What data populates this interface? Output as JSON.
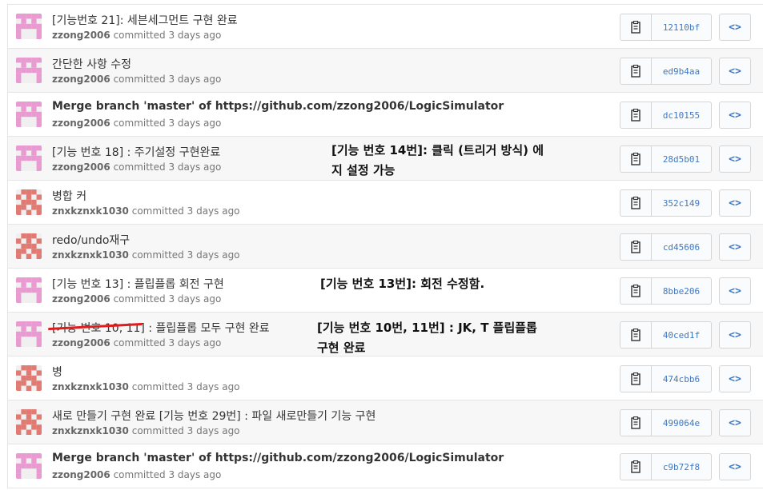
{
  "commits": [
    {
      "title": "[기능번호 21]: 세븐세그먼트 구현 완료",
      "author": "zzong2006",
      "action": "committed",
      "time": "3 days ago",
      "sha": "12110bf",
      "avatar": "pink"
    },
    {
      "title": "간단한 사항 수정",
      "author": "zzong2006",
      "action": "committed",
      "time": "3 days ago",
      "sha": "ed9b4aa",
      "avatar": "pink"
    },
    {
      "title": "Merge branch 'master' of https://github.com/zzong2006/LogicSimulator",
      "author": "zzong2006",
      "action": "committed",
      "time": "3 days ago",
      "sha": "dc10155",
      "avatar": "pink",
      "strong": true
    },
    {
      "title": "[기능 번호 18] : 주기설정 구현완료",
      "author": "zzong2006",
      "action": "committed",
      "time": "3 days ago",
      "sha": "28d5b01",
      "avatar": "pink"
    },
    {
      "title": "병합 커",
      "author": "znxkznxk1030",
      "action": "committed",
      "time": "3 days ago",
      "sha": "352c149",
      "avatar": "red"
    },
    {
      "title": "redo/undo재구",
      "author": "znxkznxk1030",
      "action": "committed",
      "time": "3 days ago",
      "sha": "cd45606",
      "avatar": "red"
    },
    {
      "title": "[기능 번호 13] : 플립플롭 회전 구현",
      "author": "zzong2006",
      "action": "committed",
      "time": "3 days ago",
      "sha": "8bbe206",
      "avatar": "pink"
    },
    {
      "title": "[기능 번호 10, 11] : 플립플롭 모두 구현 완료",
      "author": "zzong2006",
      "action": "committed",
      "time": "3 days ago",
      "sha": "40ced1f",
      "avatar": "pink"
    },
    {
      "title": "병",
      "author": "znxkznxk1030",
      "action": "committed",
      "time": "3 days ago",
      "sha": "474cbb6",
      "avatar": "red"
    },
    {
      "title": "새로 만들기 구현 완료 [기능 번호 29번] : 파일 새로만들기 기능 구현",
      "author": "znxkznxk1030",
      "action": "committed",
      "time": "3 days ago",
      "sha": "499064e",
      "avatar": "red"
    },
    {
      "title": "Merge branch 'master' of https://github.com/zzong2006/LogicSimulator",
      "author": "zzong2006",
      "action": "committed",
      "time": "3 days ago",
      "sha": "c9b72f8",
      "avatar": "pink",
      "strong": true
    }
  ],
  "annotations": {
    "note1_line1": "[기능 번호 14번]: 클릭 (트리거 방식) 에",
    "note1_line2": "지 설정 가능",
    "note2": "[기능 번호 13번]: 회전 수정함.",
    "note3_line1": "[기능 번호 10번, 11번] : JK, T 플립플롭",
    "note3_line2": "구현 완료"
  },
  "icons": {
    "copy": "clipboard-icon",
    "browse": "code-icon",
    "browse_glyph": "<>"
  },
  "colors": {
    "pink_avatar": "#e89ad1",
    "red_avatar": "#e07a72",
    "link": "#4078c0",
    "strike": "#e21b1b"
  }
}
